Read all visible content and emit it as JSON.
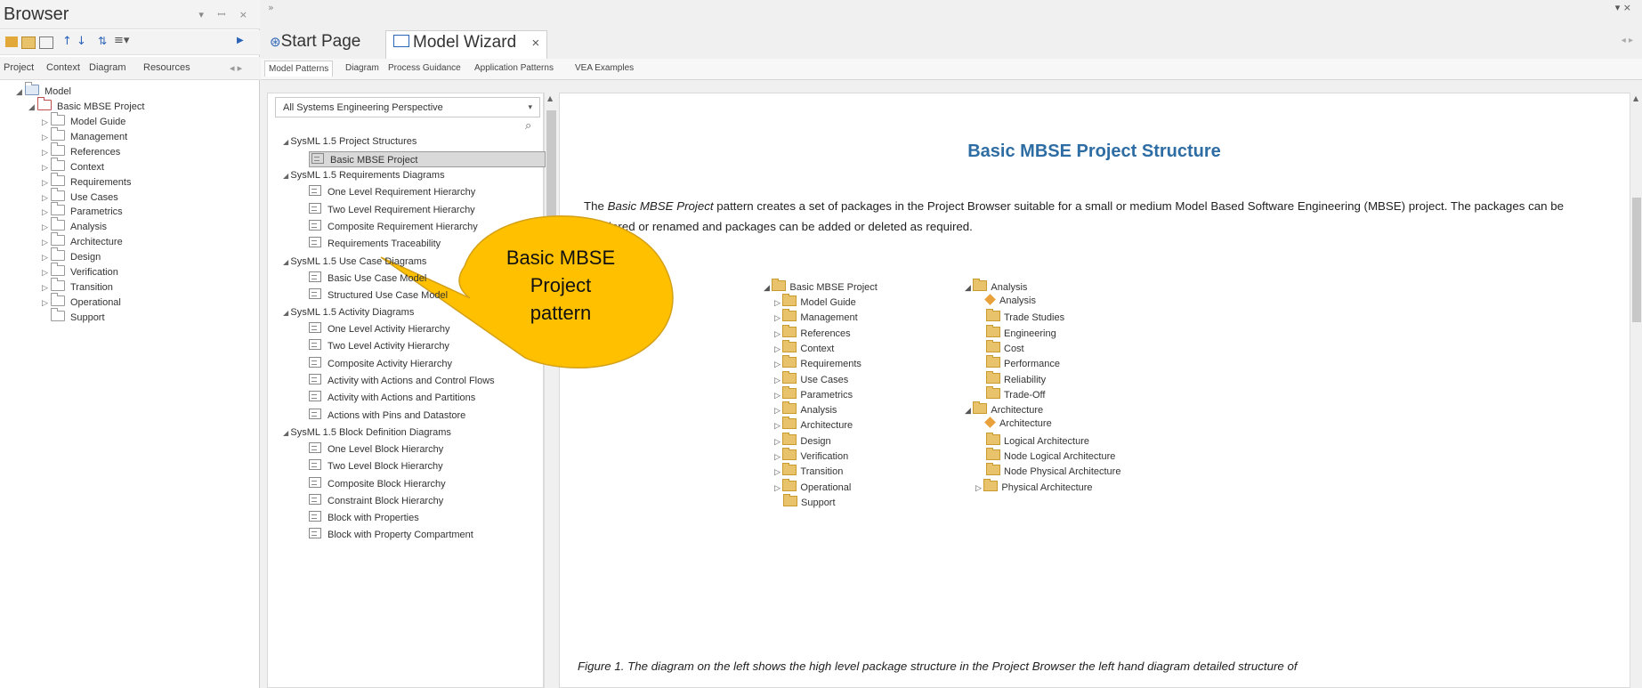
{
  "browser": {
    "title": "Browser",
    "controls": "▾ ᵽ ×",
    "tabs": [
      "Project",
      "Context",
      "Diagram",
      "Resources"
    ],
    "tree": {
      "root": "Model",
      "project": "Basic MBSE Project",
      "children": [
        "Model Guide",
        "Management",
        "References",
        "Context",
        "Requirements",
        "Use Cases",
        "Parametrics",
        "Analysis",
        "Architecture",
        "Design",
        "Verification",
        "Transition",
        "Operational",
        "Support"
      ]
    }
  },
  "doc_tabs": {
    "start_page": "Start Page",
    "model_wizard": "Model Wizard",
    "close": "×"
  },
  "wizard_tabs": [
    "Model Patterns",
    "Diagram",
    "Process Guidance",
    "Application Patterns",
    "VEA Examples"
  ],
  "pattern_panel": {
    "perspective": "All Systems Engineering Perspective",
    "groups": [
      {
        "title": "SysML 1.5 Project Structures",
        "items": [
          "Basic MBSE Project"
        ]
      },
      {
        "title": "SysML 1.5 Requirements Diagrams",
        "items": [
          "One Level Requirement Hierarchy",
          "Two Level Requirement Hierarchy",
          "Composite Requirement Hierarchy",
          "Requirements Traceability"
        ]
      },
      {
        "title": "SysML 1.5 Use Case Diagrams",
        "items": [
          "Basic Use Case Model",
          "Structured Use Case Model"
        ]
      },
      {
        "title": "SysML 1.5 Activity Diagrams",
        "items": [
          "One Level Activity Hierarchy",
          "Two Level Activity Hierarchy",
          "Composite Activity Hierarchy",
          "Activity with Actions and Control Flows",
          "Activity with Actions and Partitions",
          "Actions with Pins and Datastore"
        ]
      },
      {
        "title": "SysML 1.5 Block Definition Diagrams",
        "items": [
          "One Level Block Hierarchy",
          "Two Level Block Hierarchy",
          "Composite Block Hierarchy",
          "Constraint Block Hierarchy",
          "Block with Properties",
          "Block with Property Compartment"
        ]
      }
    ]
  },
  "content": {
    "title": "Basic MBSE Project Structure",
    "para_prefix": "The ",
    "para_em": "Basic MBSE Project",
    "para_rest": " pattern creates a set of packages in the Project Browser suitable for a small or medium Model Based Software Engineering (MBSE) project.  The packages can be reordered or renamed and packages can be added or deleted as required.",
    "caption": "Figure 1. The diagram on the left shows the high level package structure in the Project Browser the left hand diagram detailed structure of",
    "diagram_left": {
      "root": "Basic MBSE Project",
      "children": [
        "Model Guide",
        "Management",
        "References",
        "Context",
        "Requirements",
        "Use Cases",
        "Parametrics",
        "Analysis",
        "Architecture",
        "Design",
        "Verification",
        "Transition",
        "Operational",
        "Support"
      ]
    },
    "diagram_right": {
      "analysis": "Analysis",
      "analysis_children": [
        "Analysis",
        "Trade Studies",
        "Engineering",
        "Cost",
        "Performance",
        "Reliability",
        "Trade-Off"
      ],
      "architecture": "Architecture",
      "architecture_children": [
        "Architecture",
        "Logical Architecture",
        "Node Logical Architecture",
        "Node Physical Architecture",
        "Physical Architecture"
      ]
    }
  },
  "callout": {
    "line1": "Basic MBSE",
    "line2": "Project",
    "line3": "pattern",
    "fill": "#FFC000"
  }
}
